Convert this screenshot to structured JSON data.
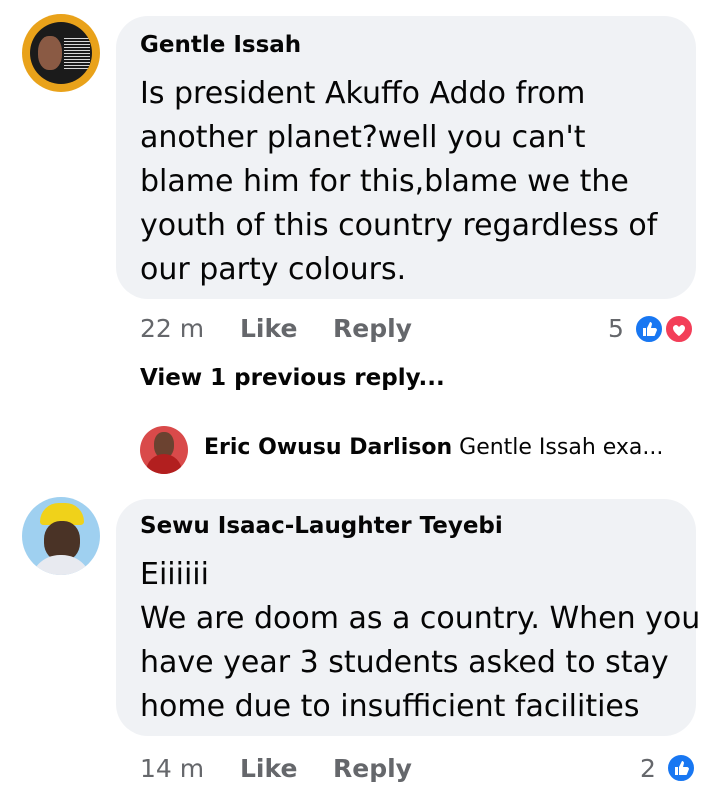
{
  "comments": [
    {
      "author": "Gentle Issah",
      "lines": [
        "Is president Akuffo Addo from",
        "another planet?well you can't",
        "blame him for this,blame we the",
        "youth of this country regardless of",
        "our party colours."
      ],
      "time": "22 m",
      "like_label": "Like",
      "reply_label": "Reply",
      "reaction_count": "5",
      "reactions": [
        "like-icon",
        "love-icon"
      ]
    },
    {
      "author": "Sewu Isaac-Laughter Teyebi",
      "lines": [
        "Eiiiiii",
        "We are doom as a country. When you",
        "have year 3 students asked to stay",
        "home due to insufficient  facilities"
      ],
      "time": "14 m",
      "like_label": "Like",
      "reply_label": "Reply",
      "reaction_count": "2",
      "reactions": [
        "like-icon"
      ]
    }
  ],
  "replies": {
    "view_previous": "View 1 previous reply...",
    "latest": {
      "author": "Eric Owusu Darlison",
      "preview": "Gentle Issah exa..."
    }
  },
  "colors": {
    "bubble": "#f0f2f5",
    "like": "#1877f2",
    "love": "#f33e58",
    "meta": "#65676b"
  }
}
